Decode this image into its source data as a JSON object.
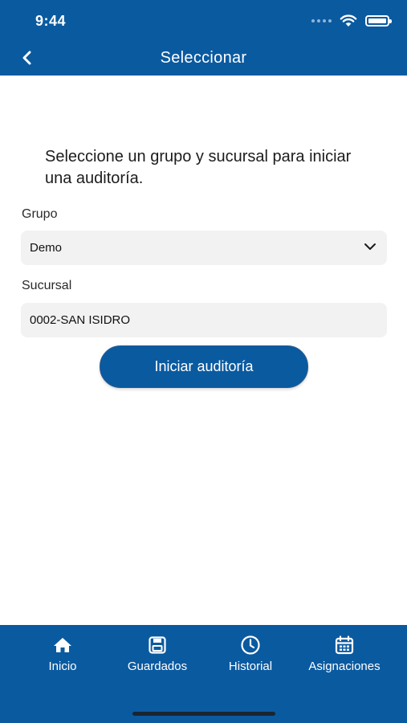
{
  "status_bar": {
    "time": "9:44"
  },
  "header": {
    "title": "Seleccionar"
  },
  "main": {
    "intro": "Seleccione un grupo y sucursal para iniciar una auditoría.",
    "grupo": {
      "label": "Grupo",
      "value": "Demo"
    },
    "sucursal": {
      "label": "Sucursal",
      "value": "0002-SAN ISIDRO"
    },
    "start_button": "Iniciar auditoría"
  },
  "tabs": [
    {
      "label": "Inicio",
      "icon": "home-icon"
    },
    {
      "label": "Guardados",
      "icon": "save-icon"
    },
    {
      "label": "Historial",
      "icon": "clock-icon"
    },
    {
      "label": "Asignaciones",
      "icon": "calendar-icon"
    }
  ],
  "colors": {
    "primary": "#0a5aa0",
    "field_bg": "#f2f2f2"
  }
}
